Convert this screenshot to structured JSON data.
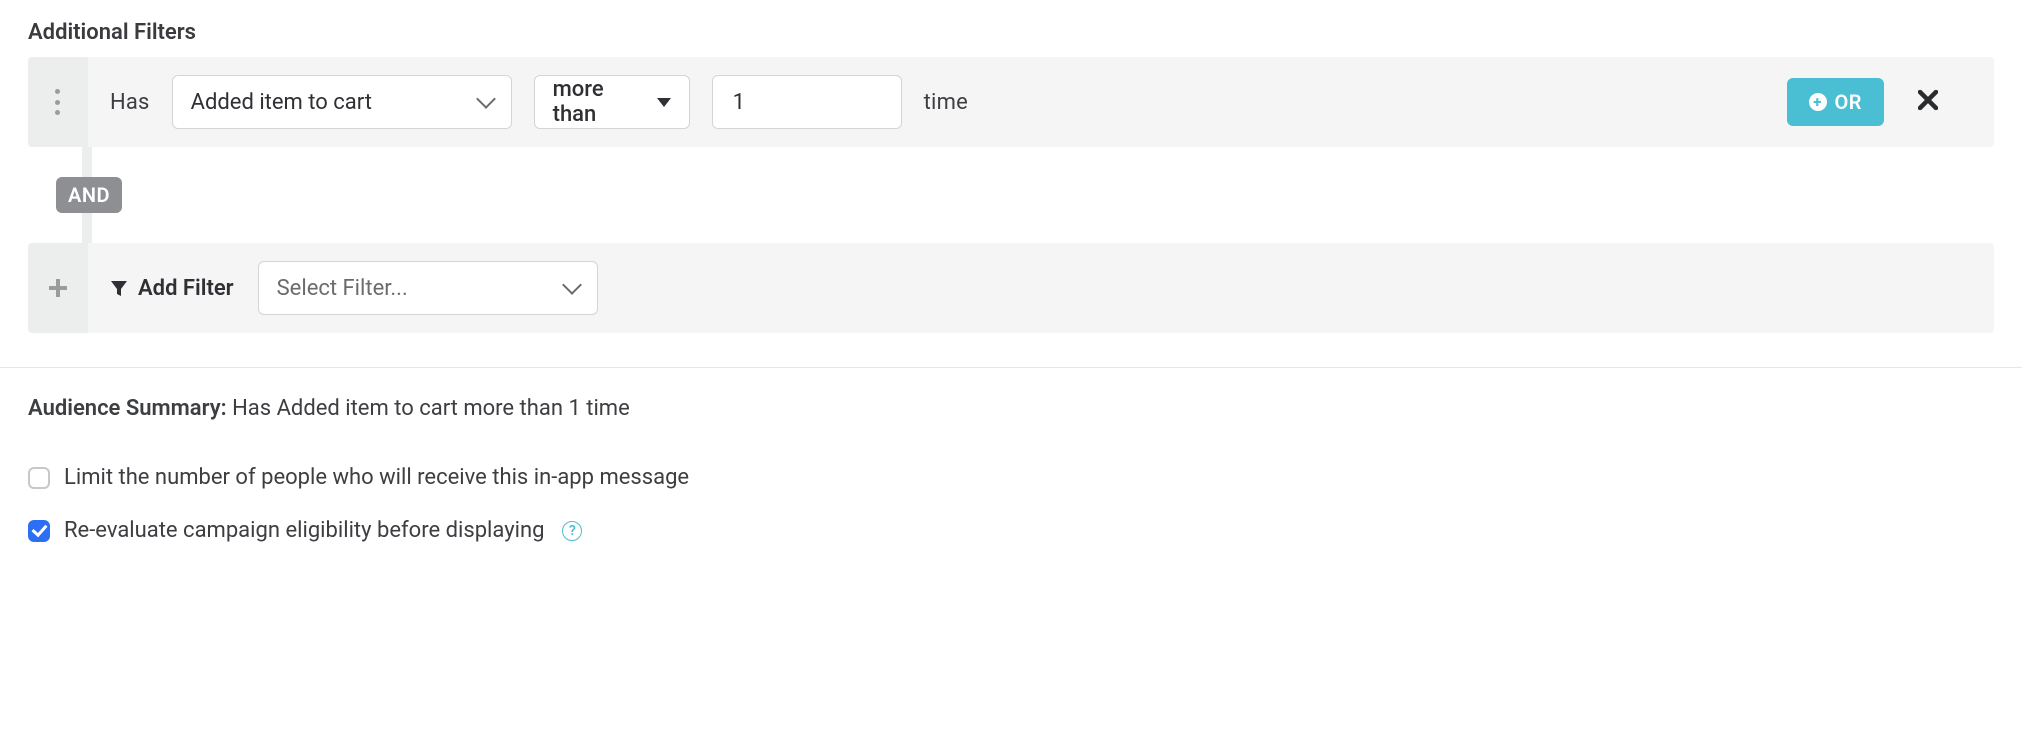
{
  "section_title": "Additional Filters",
  "filter": {
    "prefix": "Has",
    "event": "Added item to cart",
    "comparison": "more than",
    "count": "1",
    "suffix": "time",
    "or_button": "OR"
  },
  "connector": "AND",
  "add_filter": {
    "label": "Add Filter",
    "placeholder": "Select Filter..."
  },
  "summary": {
    "label": "Audience Summary:",
    "text": "Has Added item to cart more than 1 time"
  },
  "checkboxes": {
    "limit": {
      "checked": false,
      "label": "Limit the number of people who will receive this in-app message"
    },
    "reevaluate": {
      "checked": true,
      "label": "Re-evaluate campaign eligibility before displaying"
    }
  },
  "help_icon": "?"
}
